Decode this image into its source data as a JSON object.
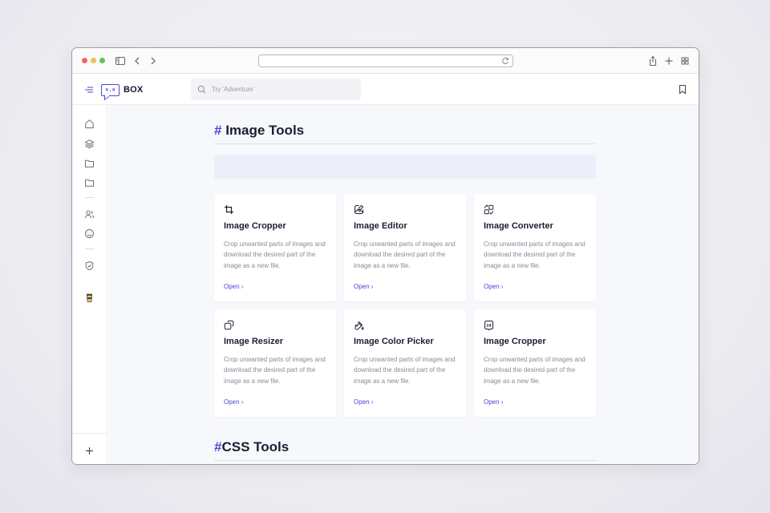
{
  "search": {
    "placeholder": "Try 'Adventure'",
    "value": ""
  },
  "logo": {
    "mark": "×.×",
    "text": "BOX"
  },
  "sidebar": {
    "items": [
      {
        "icon": "home-icon"
      },
      {
        "icon": "layers-icon"
      },
      {
        "icon": "folder-icon"
      },
      {
        "icon": "folder-icon"
      },
      {
        "icon": "users-icon"
      },
      {
        "icon": "smile-icon"
      },
      {
        "icon": "shield-icon"
      },
      {
        "icon": "coffee-cup-icon"
      }
    ]
  },
  "main": {
    "sections": [
      {
        "hash": "#",
        "title": " Image Tools",
        "cards": [
          {
            "icon": "crop-icon",
            "title": "Image Cropper",
            "description": "Crop unwanted parts of images and download the desired part of the image as a new file.",
            "link": "Open ›"
          },
          {
            "icon": "edit-image-icon",
            "title": "Image Editor",
            "description": "Crop unwanted parts of images and download the desired part of the image as a new file.",
            "link": "Open ›"
          },
          {
            "icon": "convert-icon",
            "title": "Image Converter",
            "description": "Crop unwanted parts of images and download the desired part of the image as a new file.",
            "link": "Open ›"
          },
          {
            "icon": "resize-icon",
            "title": "Image Resizer",
            "description": "Crop unwanted parts of images and download the desired part of the image as a new file.",
            "link": "Open ›"
          },
          {
            "icon": "color-picker-icon",
            "title": "Image Color Picker",
            "description": "Crop unwanted parts of images and download the desired part of the image as a new file.",
            "link": "Open ›"
          },
          {
            "icon": "badge-24-icon",
            "title": "Image Cropper",
            "description": "Crop unwanted parts of images and download the desired part of the image as a new file.",
            "link": "Open ›"
          }
        ]
      },
      {
        "hash": "#",
        "title": "CSS Tools"
      }
    ]
  },
  "badge_24_text": "24",
  "colors": {
    "accent": "#4a47d6",
    "heading": "#1d1e33",
    "muted": "#8a8b97",
    "background": "#f7f8fb",
    "banner": "#eeeefb"
  }
}
